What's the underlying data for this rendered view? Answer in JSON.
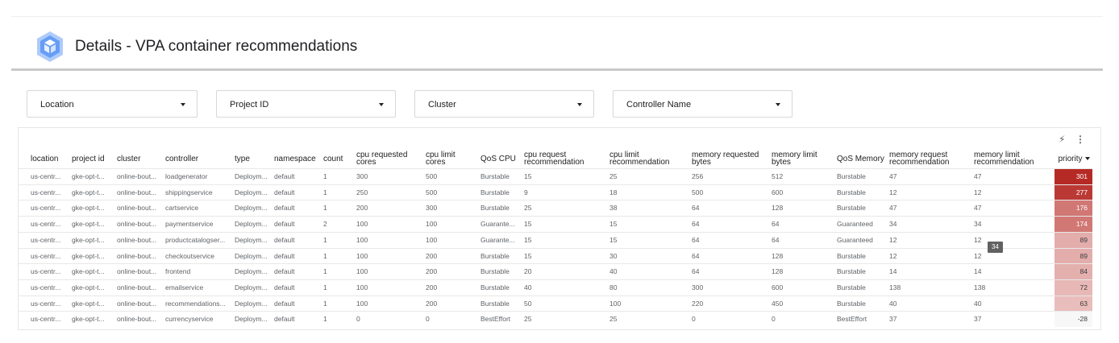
{
  "header": {
    "title": "Details - VPA container recommendations",
    "logo_icon": "gke-hexagon-icon"
  },
  "filters": [
    {
      "label": "Location"
    },
    {
      "label": "Project ID"
    },
    {
      "label": "Cluster"
    },
    {
      "label": "Controller Name"
    }
  ],
  "table": {
    "columns": [
      "location",
      "project id",
      "cluster",
      "controller",
      "type",
      "namespace",
      "count",
      "cpu requested cores",
      "cpu limit cores",
      "QoS CPU",
      "cpu request recommendation",
      "cpu limit recommendation",
      "memory requested bytes",
      "memory limit bytes",
      "QoS Memory",
      "memory request recommendation",
      "memory limit recommendation",
      "priority"
    ],
    "sorted_column": "priority",
    "sort_direction": "descending",
    "rows": [
      [
        "us-centr...",
        "gke-opt-t...",
        "online-bout...",
        "loadgenerator",
        "Deploym...",
        "default",
        "1",
        "300",
        "500",
        "Burstable",
        "15",
        "25",
        "256",
        "512",
        "Burstable",
        "47",
        "47",
        "301"
      ],
      [
        "us-centr...",
        "gke-opt-t...",
        "online-bout...",
        "shippingservice",
        "Deploym...",
        "default",
        "1",
        "250",
        "500",
        "Burstable",
        "9",
        "18",
        "500",
        "600",
        "Burstable",
        "12",
        "12",
        "277"
      ],
      [
        "us-centr...",
        "gke-opt-t...",
        "online-bout...",
        "cartservice",
        "Deploym...",
        "default",
        "1",
        "200",
        "300",
        "Burstable",
        "25",
        "38",
        "64",
        "128",
        "Burstable",
        "47",
        "47",
        "176"
      ],
      [
        "us-centr...",
        "gke-opt-t...",
        "online-bout...",
        "paymentservice",
        "Deploym...",
        "default",
        "2",
        "100",
        "100",
        "Guarante...",
        "15",
        "15",
        "64",
        "64",
        "Guaranteed",
        "34",
        "34",
        "174"
      ],
      [
        "us-centr...",
        "gke-opt-t...",
        "online-bout...",
        "productcatalogser...",
        "Deploym...",
        "default",
        "1",
        "100",
        "100",
        "Guarante...",
        "15",
        "15",
        "64",
        "64",
        "Guaranteed",
        "12",
        "12",
        "89"
      ],
      [
        "us-centr...",
        "gke-opt-t...",
        "online-bout...",
        "checkoutservice",
        "Deploym...",
        "default",
        "1",
        "100",
        "200",
        "Burstable",
        "15",
        "30",
        "64",
        "128",
        "Burstable",
        "12",
        "12",
        "89"
      ],
      [
        "us-centr...",
        "gke-opt-t...",
        "online-bout...",
        "frontend",
        "Deploym...",
        "default",
        "1",
        "100",
        "200",
        "Burstable",
        "20",
        "40",
        "64",
        "128",
        "Burstable",
        "14",
        "14",
        "84"
      ],
      [
        "us-centr...",
        "gke-opt-t...",
        "online-bout...",
        "emailservice",
        "Deploym...",
        "default",
        "1",
        "100",
        "200",
        "Burstable",
        "40",
        "80",
        "300",
        "600",
        "Burstable",
        "138",
        "138",
        "72"
      ],
      [
        "us-centr...",
        "gke-opt-t...",
        "online-bout...",
        "recommendations...",
        "Deploym...",
        "default",
        "1",
        "100",
        "200",
        "Burstable",
        "50",
        "100",
        "220",
        "450",
        "Burstable",
        "40",
        "40",
        "63"
      ],
      [
        "us-centr...",
        "gke-opt-t...",
        "online-bout...",
        "currencyservice",
        "Deploym...",
        "default",
        "1",
        "0",
        "0",
        "BestEffort",
        "25",
        "25",
        "0",
        "0",
        "BestEffort",
        "37",
        "37",
        "-28"
      ]
    ]
  },
  "tooltip": {
    "text": "34"
  },
  "heatmap_colors": {
    "high": "#b62a25",
    "low": "#f6e4e3",
    "negative": "#f7f7f7"
  },
  "toolbar_icons": [
    "bolt-icon",
    "more-vert-icon"
  ]
}
